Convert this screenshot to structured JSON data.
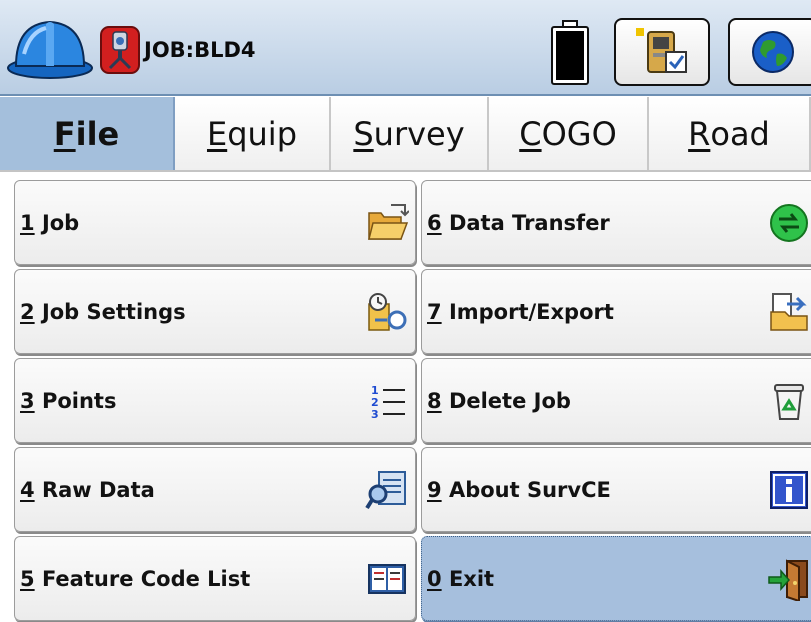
{
  "title_bar": {
    "job_title": "JOB:BLD4",
    "icons": [
      "hardhat-icon",
      "app-logo-icon",
      "battery-icon",
      "instrument-icon",
      "globe-icon"
    ]
  },
  "tabs": [
    {
      "accel": "F",
      "rest": "ile",
      "active": true
    },
    {
      "accel": "E",
      "rest": "quip",
      "active": false
    },
    {
      "accel": "S",
      "rest": "urvey",
      "active": false
    },
    {
      "accel": "C",
      "rest": "OGO",
      "active": false
    },
    {
      "accel": "R",
      "rest": "oad",
      "active": false
    }
  ],
  "menu": {
    "items": [
      {
        "num": "1",
        "label": "Job",
        "icon": "open-folder-icon"
      },
      {
        "num": "2",
        "label": "Job Settings",
        "icon": "settings-key-icon"
      },
      {
        "num": "3",
        "label": "Points",
        "icon": "numbered-list-icon"
      },
      {
        "num": "4",
        "label": "Raw Data",
        "icon": "raw-data-icon"
      },
      {
        "num": "5",
        "label": "Feature Code List",
        "icon": "code-book-icon"
      },
      {
        "num": "6",
        "label": "Data Transfer",
        "icon": "transfer-icon"
      },
      {
        "num": "7",
        "label": "Import/Export",
        "icon": "import-export-icon"
      },
      {
        "num": "8",
        "label": "Delete Job",
        "icon": "recycle-bin-icon"
      },
      {
        "num": "9",
        "label": "About SurvCE",
        "icon": "info-icon"
      },
      {
        "num": "0",
        "label": "Exit",
        "icon": "exit-door-icon",
        "selected": true
      }
    ]
  },
  "colors": {
    "active_tab": "#a4bfdc",
    "selected_button": "#a6bfdd",
    "title_bar": "#c8d9eb"
  }
}
